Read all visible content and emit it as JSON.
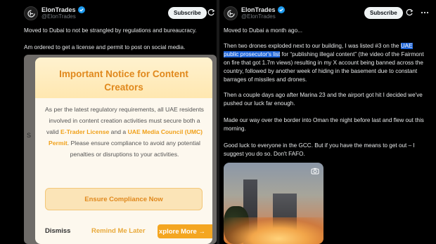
{
  "left_post": {
    "author_name": "ElonTrades",
    "author_handle": "@ElonTrades",
    "subscribe_label": "Subscribe",
    "line1": "Moved to Dubai to not be strangled by regulations and bureaucracy.",
    "line2": "Am ordered to get a license and permit to post on social media.",
    "background_sliver_text": "S"
  },
  "notice": {
    "title_line1": "Important Notice for Content",
    "title_line2": "Creators",
    "body_part1": "As per the latest regulatory requirements, all UAE residents involved in content creation activities must secure both a valid",
    "link1": "E-Trader License",
    "body_part2": "and a",
    "link2": "UAE Media Council (UMC) Permit",
    "body_part3": ". Please ensure compliance to avoid any potential penalties or disruptions to your activities.",
    "cta_label": "Ensure Compliance Now",
    "dismiss_label": "Dismiss",
    "remind_label": "Remind Me Later",
    "explore_label": "xplore More →"
  },
  "right_post": {
    "author_name": "ElonTrades",
    "author_handle": "@ElonTrades",
    "subscribe_label": "Subscribe",
    "p1": "Moved to Dubai a month ago...",
    "p2_before": "Then two drones exploded next to our building, I was listed #3 on the",
    "p2_highlight": "UAE public prosecutor's list",
    "p2_after": "for “publishing illegal content” (the video of the Fairmont on fire that got 1.7m views) resulting in my X account being banned across the country, followed by another week of hiding in the basement due to constant barrages of missiles and drones.",
    "p3": "Then a couple days ago after Marina 23 and the airport got hit I decided we've pushed our luck far enough.",
    "p4": "Made our way over the border into Oman the night before last and flew out this morning.",
    "p5": "Good luck to everyone in the GCC. But if you have the means to get out – I suggest you do so. Don't FAFO."
  },
  "colors": {
    "background": "#000000",
    "verified_blue": "#1d9bf0",
    "notice_orange": "#e0881c",
    "explore_orange": "#f4a621",
    "highlight_blue": "#1d63d6"
  },
  "icons": [
    "avatar-logo-icon",
    "verified-badge-icon",
    "grok-icon",
    "more-icon",
    "camera-icon"
  ]
}
